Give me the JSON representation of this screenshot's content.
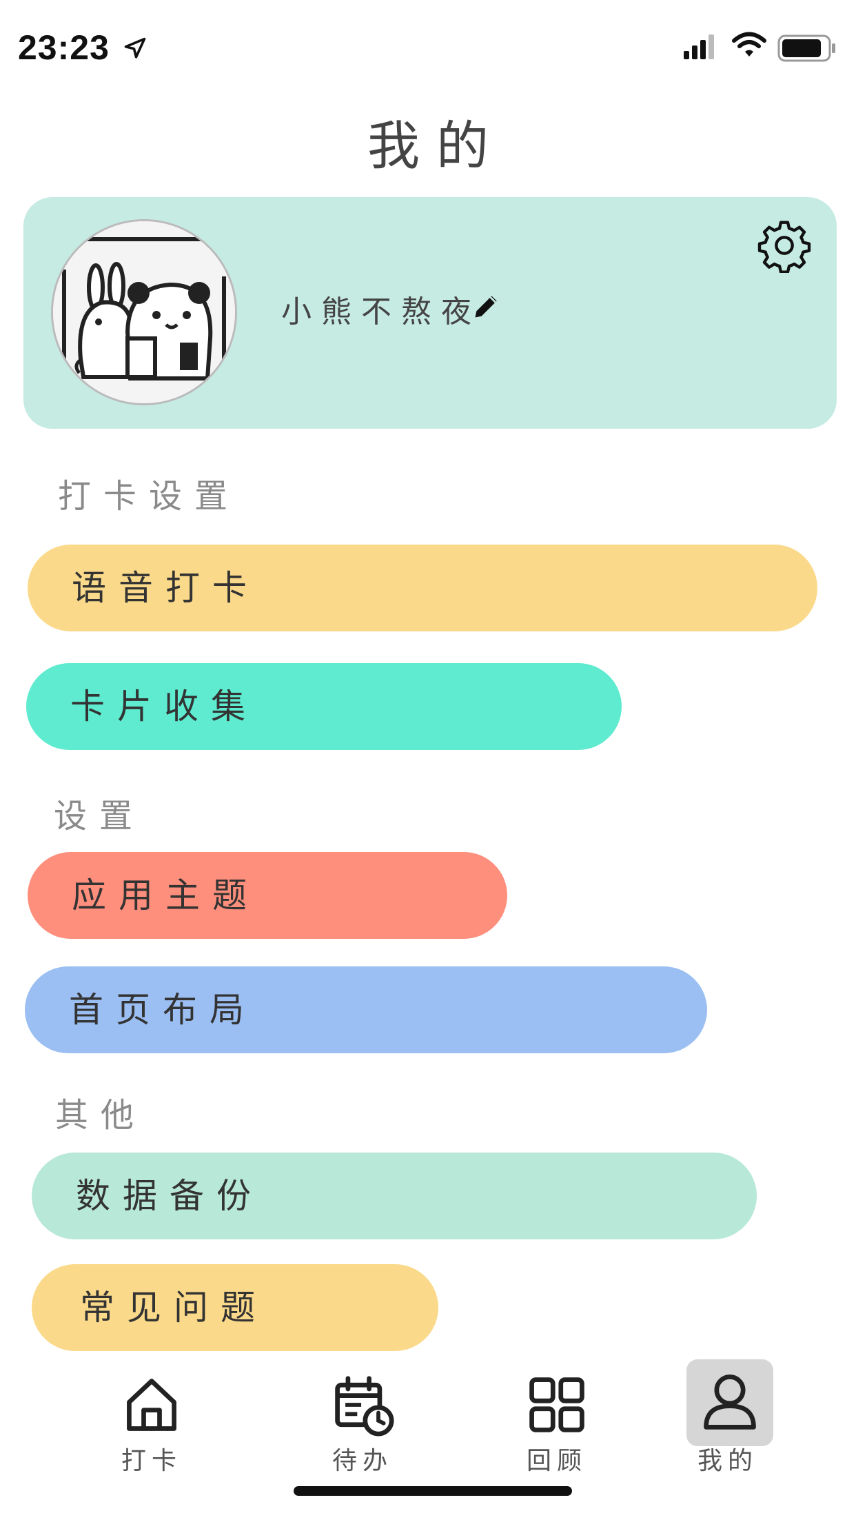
{
  "status_bar": {
    "time": "23:23"
  },
  "header": {
    "title": "我的"
  },
  "profile": {
    "username": "小熊不熬夜"
  },
  "sections": {
    "checkin": "打卡设置",
    "settings": "设置",
    "other": "其他"
  },
  "menu": {
    "voice_checkin": {
      "label": "语音打卡",
      "color": "#fada8a"
    },
    "card_collection": {
      "label": "卡片收集",
      "color": "#5eebd0"
    },
    "app_theme": {
      "label": "应用主题",
      "color": "#fe8f7c"
    },
    "home_layout": {
      "label": "首页布局",
      "color": "#9bbff2"
    },
    "data_backup": {
      "label": "数据备份",
      "color": "#b7e8d8"
    },
    "faq": {
      "label": "常见问题",
      "color": "#fada8a"
    }
  },
  "tabbar": {
    "items": [
      {
        "label": "打卡",
        "icon": "home-icon"
      },
      {
        "label": "待办",
        "icon": "calendar-clock-icon"
      },
      {
        "label": "回顾",
        "icon": "grid-icon"
      },
      {
        "label": "我的",
        "icon": "person-icon",
        "active": true
      }
    ]
  }
}
